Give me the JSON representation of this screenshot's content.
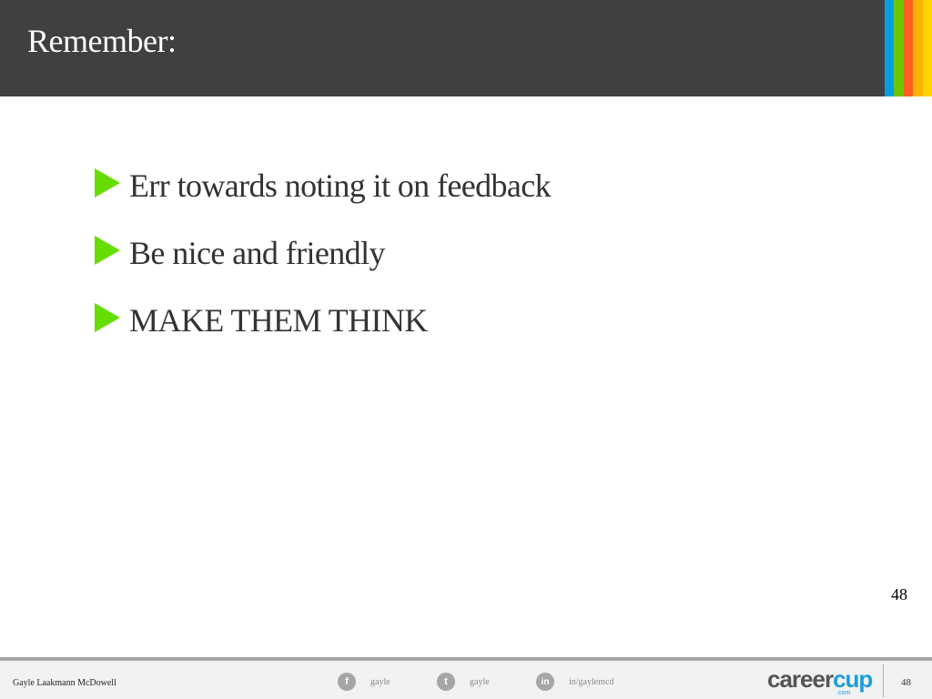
{
  "slide": {
    "title": "Remember:",
    "accent_stripes": [
      "#00a0e0",
      "#6dc400",
      "#ff5f1f",
      "#ffb400",
      "#ffd400"
    ],
    "bullet_color": "#66dd00",
    "bullets": [
      "Err towards noting it on feedback",
      "Be nice and friendly",
      "MAKE THEM THINK"
    ],
    "slide_number": "48"
  },
  "footer": {
    "author": "Gayle Laakmann McDowell",
    "facebook": {
      "icon": "facebook-icon",
      "glyph": "f",
      "label": "gayle"
    },
    "twitter": {
      "icon": "twitter-icon",
      "glyph": "t",
      "label": "gayle"
    },
    "linkedin": {
      "icon": "linkedin-icon",
      "glyph": "in",
      "label": "in/gaylemcd"
    },
    "brand": {
      "part1": "career",
      "part2": "cup",
      "suffix": ".com"
    },
    "page_number": "48"
  }
}
